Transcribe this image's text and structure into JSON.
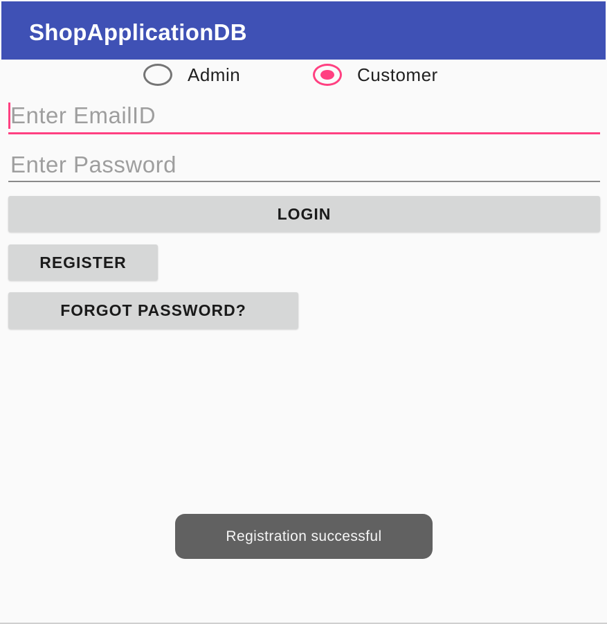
{
  "app_bar": {
    "title": "ShopApplicationDB"
  },
  "role_selector": {
    "options": [
      {
        "label": "Admin",
        "checked": false
      },
      {
        "label": "Customer",
        "checked": true
      }
    ]
  },
  "form": {
    "email": {
      "placeholder": "Enter EmailID",
      "value": "",
      "focused": true
    },
    "password": {
      "placeholder": "Enter Password",
      "value": ""
    }
  },
  "buttons": {
    "login": "LOGIN",
    "register": "REGISTER",
    "forgot_password": "FORGOT PASSWORD?"
  },
  "toast": {
    "message": "Registration successful"
  },
  "colors": {
    "primary": "#3f51b5",
    "accent": "#ff4081",
    "button_bg": "#d6d7d7",
    "toast_bg": "#616161"
  }
}
